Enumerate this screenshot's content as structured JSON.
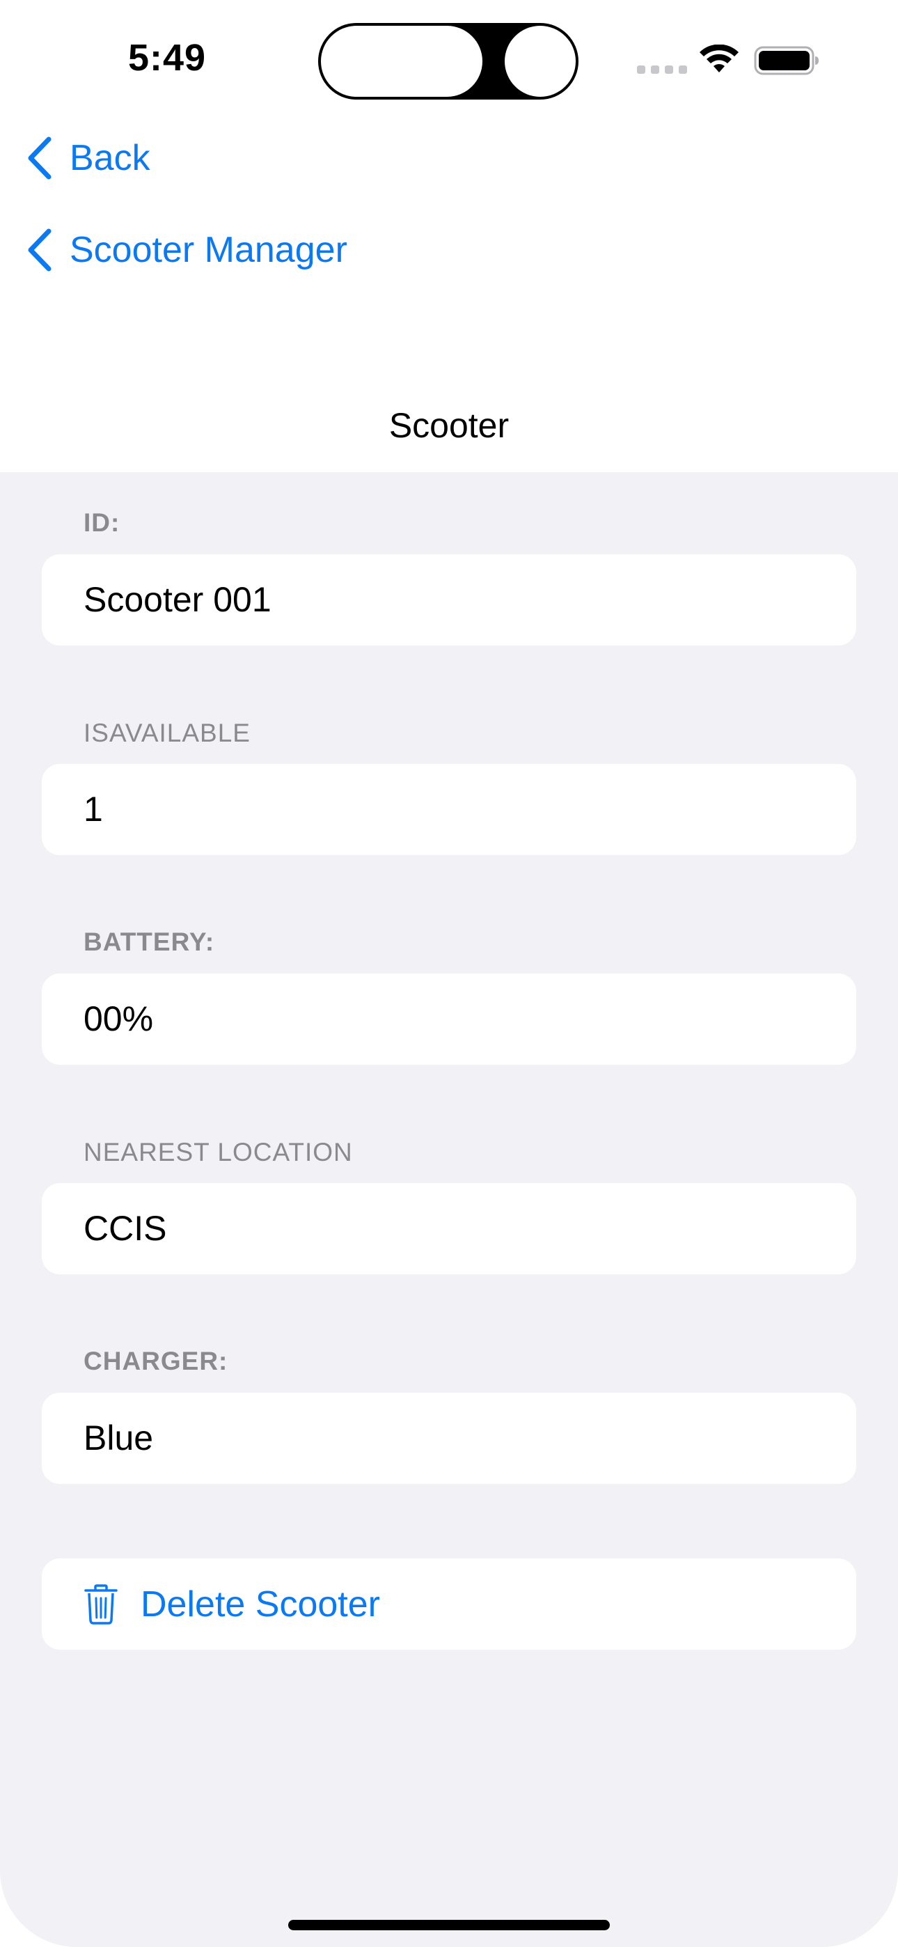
{
  "status_bar": {
    "time": "5:49"
  },
  "nav": {
    "back_label": "Back",
    "parent_label": "Scooter Manager",
    "title": "Scooter"
  },
  "fields": [
    {
      "label": "ID:",
      "value": "Scooter 001"
    },
    {
      "label": "ISAVAILABLE",
      "value": "1"
    },
    {
      "label": "BATTERY:",
      "value": "00%"
    },
    {
      "label": "NEAREST LOCATION",
      "value": "CCIS"
    },
    {
      "label": "CHARGER:",
      "value": "Blue"
    }
  ],
  "actions": {
    "delete_label": "Delete Scooter"
  },
  "colors": {
    "accent": "#0a79f2",
    "background": "#f1f1f6",
    "label": "#8a8a8e"
  }
}
